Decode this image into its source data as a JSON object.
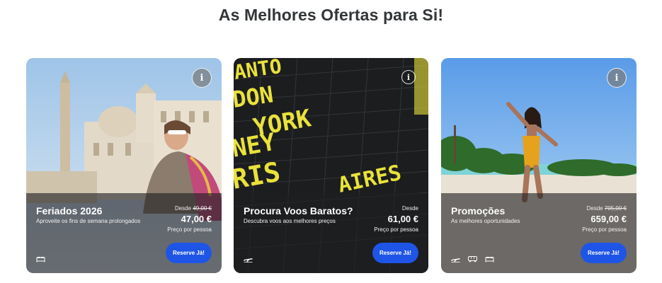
{
  "section": {
    "title": "As Melhores Ofertas para Si!"
  },
  "cards": [
    {
      "title": "Feriados 2026",
      "subtitle": "Aproveite os fins de semana prolongados",
      "from_label": "Desde",
      "old_price": "49,00 €",
      "price": "47,00 €",
      "per_person": "Preço por pessoa",
      "button": "Reserve Já!",
      "info": "i",
      "icons": [
        "bed-icon"
      ]
    },
    {
      "title": "Procura Voos Baratos?",
      "subtitle": "Descubra voos aos melhores preços",
      "from_label": "Desde",
      "price": "61,00 €",
      "per_person": "Preço por pessoa",
      "button": "Reserve Já!",
      "info": "i",
      "icons": [
        "plane-icon"
      ]
    },
    {
      "title": "Promoções",
      "subtitle": "As melhores oportunidades",
      "from_label": "Desde",
      "old_price": "705,00 €",
      "price": "659,00 €",
      "per_person": "Preço por pessoa",
      "button": "Reserve Já!",
      "info": "i",
      "icons": [
        "plane-icon",
        "bus-icon",
        "bed-icon"
      ]
    }
  ],
  "flight_board_text": [
    "ANTO",
    "DON",
    "YORK",
    "NEY",
    "RIS",
    "AIRES"
  ]
}
